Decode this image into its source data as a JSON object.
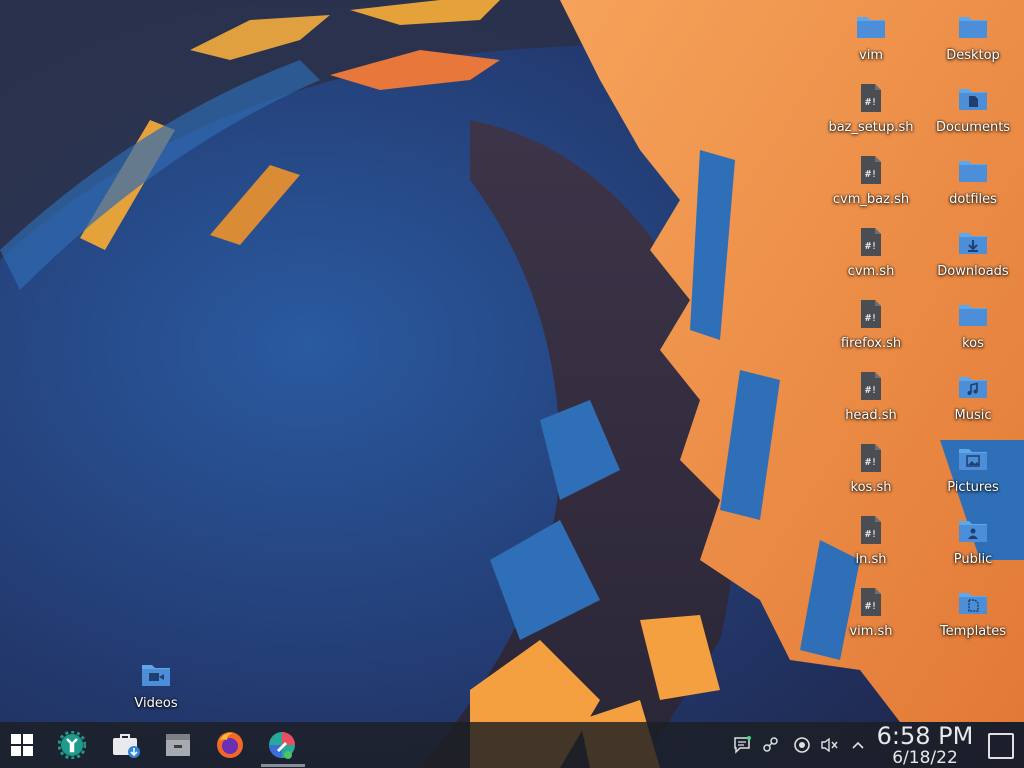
{
  "desktop": {
    "icons": [
      {
        "label": "vim",
        "type": "folder",
        "icon": "folder-icon"
      },
      {
        "label": "Desktop",
        "type": "folder",
        "icon": "folder-icon"
      },
      {
        "label": "baz_setup.sh",
        "type": "script",
        "icon": "shell-script-icon"
      },
      {
        "label": "Documents",
        "type": "folder",
        "icon": "folder-documents-icon"
      },
      {
        "label": "cvm_baz.sh",
        "type": "script",
        "icon": "shell-script-icon"
      },
      {
        "label": "dotfiles",
        "type": "folder",
        "icon": "folder-icon"
      },
      {
        "label": "cvm.sh",
        "type": "script",
        "icon": "shell-script-icon"
      },
      {
        "label": "Downloads",
        "type": "folder",
        "icon": "folder-downloads-icon"
      },
      {
        "label": "firefox.sh",
        "type": "script",
        "icon": "shell-script-icon"
      },
      {
        "label": "kos",
        "type": "folder",
        "icon": "folder-icon"
      },
      {
        "label": "head.sh",
        "type": "script",
        "icon": "shell-script-icon"
      },
      {
        "label": "Music",
        "type": "folder",
        "icon": "folder-music-icon"
      },
      {
        "label": "kos.sh",
        "type": "script",
        "icon": "shell-script-icon"
      },
      {
        "label": "Pictures",
        "type": "folder",
        "icon": "folder-pictures-icon"
      },
      {
        "label": "ln.sh",
        "type": "script",
        "icon": "shell-script-icon"
      },
      {
        "label": "Public",
        "type": "folder",
        "icon": "folder-public-icon"
      },
      {
        "label": "vim.sh",
        "type": "script",
        "icon": "shell-script-icon"
      },
      {
        "label": "Templates",
        "type": "folder",
        "icon": "folder-templates-icon"
      },
      {
        "label": "Videos",
        "type": "folder",
        "icon": "folder-videos-icon"
      }
    ]
  },
  "taskbar": {
    "launchers": [
      {
        "icon": "application-launcher-icon"
      },
      {
        "icon": "system-settings-icon"
      },
      {
        "icon": "discover-store-icon"
      },
      {
        "icon": "file-manager-icon"
      },
      {
        "icon": "firefox-icon"
      },
      {
        "icon": "color-picker-icon",
        "active": true
      }
    ],
    "tray": [
      {
        "icon": "notifications-icon"
      },
      {
        "icon": "kde-connect-icon"
      },
      {
        "icon": "update-icon"
      },
      {
        "icon": "volume-muted-icon"
      },
      {
        "icon": "expand-tray-icon"
      }
    ],
    "clock": {
      "time": "6:58 PM",
      "date": "6/18/22"
    },
    "show_desktop": {
      "icon": "show-desktop-icon"
    }
  },
  "colors": {
    "folder_blue": "#4c8fd8",
    "folder_tab": "#5ea7ea",
    "orange": "#f08f46",
    "taskbar_bg": "#1c1e24"
  }
}
